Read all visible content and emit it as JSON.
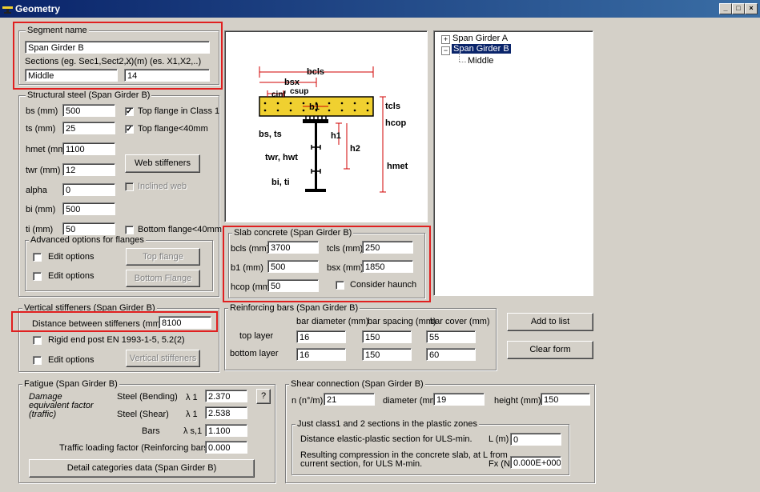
{
  "window": {
    "title": "Geometry",
    "min": "_",
    "max": "□",
    "close": "×"
  },
  "segment": {
    "legend": "Segment name",
    "name": "Span Girder B",
    "sections_label": "Sections (eg. Sec1,Sect2,..)",
    "x_label": "X (m) (es. X1,X2,..)",
    "sections_value": "Middle",
    "x_value": "14"
  },
  "steel": {
    "legend": "Structural steel  (Span Girder B)",
    "bs_label": "bs (mm)",
    "bs": "500",
    "ts_label": "ts (mm)",
    "ts": "25",
    "hmet_label": "hmet (mm)",
    "hmet": "1100",
    "twr_label": "twr (mm)",
    "twr": "12",
    "alpha_label": "alpha",
    "alpha": "0",
    "bi_label": "bi (mm)",
    "bi": "500",
    "ti_label": "ti (mm)",
    "ti": "50",
    "top_class1": "Top flange in Class 1",
    "top_40": "Top flange<40mm",
    "web_stiffeners": "Web stiffeners",
    "inclined_web": "Inclined web",
    "bottom_40": "Bottom flange<40mm",
    "check_mark": "✓"
  },
  "advanced": {
    "legend": "Advanced options for flanges",
    "edit1": "Edit options",
    "edit2": "Edit options",
    "top_flange": "Top flange",
    "bottom_flange": "Bottom Flange"
  },
  "drawing": {
    "bcls": "bcls",
    "bsx": "bsx",
    "cinf": "cinf",
    "csup": "csup",
    "b1": "b1",
    "tcls": "tcls",
    "hcop": "hcop",
    "bs_ts": "bs, ts",
    "h1": "h1",
    "h2": "h2",
    "twr_hwt": "twr, hwt",
    "hmet": "hmet",
    "bi_ti": "bi, ti"
  },
  "tree": {
    "root_a": "Span Girder A",
    "root_b": "Span Girder B",
    "child": "Middle",
    "plus": "+",
    "minus": "−"
  },
  "slab": {
    "legend": "Slab concrete  (Span Girder B)",
    "bcls_label": "bcls (mm)",
    "bcls": "3700",
    "tcls_label": "tcls (mm)",
    "tcls": "250",
    "b1_label": "b1 (mm)",
    "b1": "500",
    "bsx_label": "bsx (mm)",
    "bsx": "1850",
    "hcop_label": "hcop (mm)",
    "hcop": "50",
    "haunch": "Consider haunch"
  },
  "vertical": {
    "legend": "Vertical stiffeners (Span Girder B)",
    "distance_label": "Distance between stiffeners (mm)",
    "distance": "8100",
    "rigid": "Rigid end post EN 1993-1-5, 5.2(2)",
    "edit": "Edit options",
    "button": "Vertical stiffeners"
  },
  "rebar": {
    "legend": "Reinforcing bars  (Span Girder B)",
    "col_diameter": "bar diameter (mm)",
    "col_spacing": "bar spacing (mm)",
    "col_cover": "bar cover (mm)",
    "top_label": "top layer",
    "bottom_label": "bottom layer",
    "top": [
      "16",
      "150",
      "55"
    ],
    "bottom": [
      "16",
      "150",
      "60"
    ]
  },
  "actions": {
    "add": "Add to list",
    "clear": "Clear form"
  },
  "fatigue": {
    "legend": "Fatigue  (Span Girder B)",
    "damage1": "Damage",
    "damage2": "equivalent factor",
    "damage3": "(traffic)",
    "bending_label": "Steel (Bending)",
    "shear_label": "Steel (Shear)",
    "bars_label": "Bars",
    "lambda1": "λ 1",
    "lambda2": "λ 1",
    "lambda3": "λ s,1",
    "bending": "2.370",
    "shear": "2.538",
    "bars": "1.100",
    "help": "?",
    "traffic_label": "Traffic loading factor (Reinforcing bars)",
    "traffic": "0.000",
    "detail_button": "Detail categories data  (Span Girder B)"
  },
  "shear": {
    "legend": "Shear connection  (Span Girder B)",
    "n_label": "n (n°/m)",
    "n": "21",
    "diam_label": "diameter (mm)",
    "diam": "19",
    "height_label": "height (mm)",
    "height": "150",
    "plastic_legend": "Just class1 and 2 sections in the plastic zones",
    "distance_label": "Distance elastic-plastic section for ULS-min.",
    "l_label": "L (m)",
    "l": "0",
    "comp_label1": "Resulting compression in the concrete slab, at L from",
    "comp_label2": "current section, for ULS M-min.",
    "fx_label": "Fx (N)",
    "fx": "0.000E+000"
  },
  "colors": {
    "highlight": "#e02020",
    "slab_fill": "#f0d030",
    "tree_selected": "#0a246a",
    "dimension": "#d00000"
  }
}
